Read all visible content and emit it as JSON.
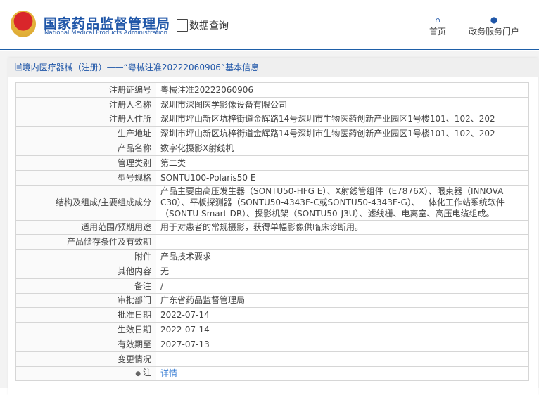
{
  "header": {
    "logo_cn": "国家药品监督管理局",
    "logo_en": "National Medical Products Administration",
    "data_query": "数据查询",
    "nav": [
      {
        "label": "首页",
        "icon": "home-icon"
      },
      {
        "label": "政务服务门户",
        "icon": "user-icon"
      }
    ]
  },
  "panel": {
    "title": "境内医疗器械（注册）——“粤械注准20222060906”基本信息"
  },
  "rows": [
    {
      "label": "注册证编号",
      "value": "粤械注准20222060906"
    },
    {
      "label": "注册人名称",
      "value": "深圳市深图医学影像设备有限公司"
    },
    {
      "label": "注册人住所",
      "value": "深圳市坪山新区坑梓街道金辉路14号深圳市生物医药创新产业园区1号楼101、102、202"
    },
    {
      "label": "生产地址",
      "value": "深圳市坪山新区坑梓街道金辉路14号深圳市生物医药创新产业园区1号楼101、102、202"
    },
    {
      "label": "产品名称",
      "value": "数字化摄影X射线机"
    },
    {
      "label": "管理类别",
      "value": "第二类"
    },
    {
      "label": "型号规格",
      "value": "SONTU100-Polaris50 E"
    },
    {
      "label": "结构及组成/主要组成成分",
      "value": "产品主要由高压发生器（SONTU50-HFG E）、X射线管组件（E7876X）、限束器（INNOVA C30）、平板探测器（SONTU50-4343F-C或SONTU50-4343F-G）、一体化工作站系统软件（SONTU Smart-DR）、摄影机架（SONTU50-J3U）、滤线栅、电离室、高压电缆组成。"
    },
    {
      "label": "适用范围/预期用途",
      "value": "用于对患者的常规摄影，获得单幅影像供临床诊断用。"
    },
    {
      "label": "产品储存条件及有效期",
      "value": ""
    },
    {
      "label": "附件",
      "value": "产品技术要求"
    },
    {
      "label": "其他内容",
      "value": "无"
    },
    {
      "label": "备注",
      "value": "/"
    },
    {
      "label": "审批部门",
      "value": "广东省药品监督管理局"
    },
    {
      "label": "批准日期",
      "value": "2022-07-14"
    },
    {
      "label": "生效日期",
      "value": "2022-07-14"
    },
    {
      "label": "有效期至",
      "value": "2027-07-13"
    },
    {
      "label": "变更情况",
      "value": ""
    },
    {
      "label": "注",
      "value": "详情"
    }
  ]
}
